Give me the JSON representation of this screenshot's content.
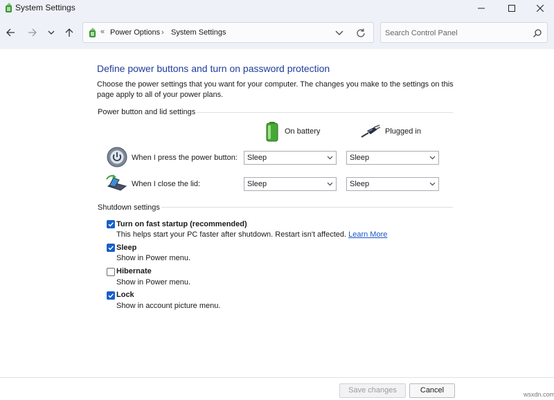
{
  "window": {
    "title": "System Settings",
    "icons": {
      "minimize": "minimize-icon",
      "maximize": "maximize-icon",
      "close": "close-icon"
    }
  },
  "nav": {
    "breadcrumb_chevron": "«",
    "crumbs": [
      "Power Options",
      "System Settings"
    ],
    "separator": "›",
    "search": {
      "placeholder": "Search Control Panel"
    }
  },
  "main": {
    "heading": "Define power buttons and turn on password protection",
    "description": "Choose the power settings that you want for your computer. The changes you make to the settings on this page apply to all of your power plans.",
    "power_group": {
      "label": "Power button and lid settings",
      "columns": {
        "battery": "On battery",
        "plugged": "Plugged in"
      },
      "rows": [
        {
          "label": "When I press the power button:",
          "battery": "Sleep",
          "plugged": "Sleep"
        },
        {
          "label": "When I close the lid:",
          "battery": "Sleep",
          "plugged": "Sleep"
        }
      ]
    },
    "shutdown_group": {
      "label": "Shutdown settings",
      "items": [
        {
          "title": "Turn on fast startup (recommended)",
          "desc": "This helps start your PC faster after shutdown. Restart isn't affected.",
          "link": "Learn More",
          "checked": true
        },
        {
          "title": "Sleep",
          "desc": "Show in Power menu.",
          "checked": true
        },
        {
          "title": "Hibernate",
          "desc": "Show in Power menu.",
          "checked": false
        },
        {
          "title": "Lock",
          "desc": "Show in account picture menu.",
          "checked": true
        }
      ]
    }
  },
  "footer": {
    "save_label": "Save changes",
    "cancel_label": "Cancel"
  },
  "watermark": "wsxdn.com",
  "colors": {
    "accent": "#1760c9",
    "heading": "#1e3d9c",
    "link": "#1a55c5",
    "chrome": "#eef1f8"
  }
}
